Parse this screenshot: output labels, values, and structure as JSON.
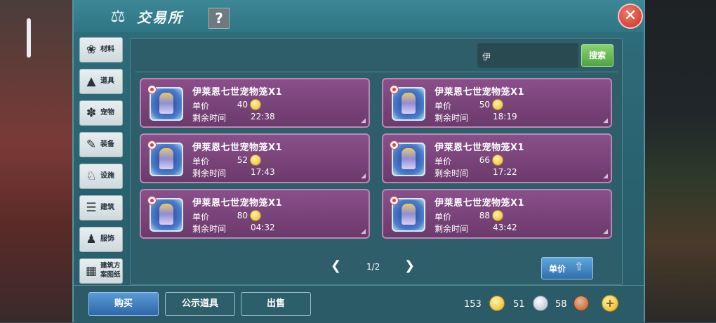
{
  "window": {
    "title": "交易所",
    "help_label": "?",
    "close_label": "✕"
  },
  "sidebar": {
    "items": [
      {
        "label": "材料",
        "icon": "material-icon"
      },
      {
        "label": "道具",
        "icon": "flask-icon"
      },
      {
        "label": "宠物",
        "icon": "paw-icon"
      },
      {
        "label": "装备",
        "icon": "equipment-icon"
      },
      {
        "label": "设施",
        "icon": "facility-icon"
      },
      {
        "label": "建筑",
        "icon": "building-icon"
      },
      {
        "label": "服饰",
        "icon": "clothing-icon"
      },
      {
        "label": "建筑方案图纸",
        "icon": "blueprint-icon"
      }
    ]
  },
  "search": {
    "value": "伊",
    "button_label": "搜索"
  },
  "listings": {
    "price_label": "单价",
    "time_label": "剩余时间",
    "items": [
      {
        "name": "伊莱恩七世宠物笼X1",
        "price": "40",
        "time": "22:38"
      },
      {
        "name": "伊莱恩七世宠物笼X1",
        "price": "50",
        "time": "18:19"
      },
      {
        "name": "伊莱恩七世宠物笼X1",
        "price": "52",
        "time": "17:43"
      },
      {
        "name": "伊莱恩七世宠物笼X1",
        "price": "66",
        "time": "17:22"
      },
      {
        "name": "伊莱恩七世宠物笼X1",
        "price": "80",
        "time": "04:32"
      },
      {
        "name": "伊莱恩七世宠物笼X1",
        "price": "88",
        "time": "43:42"
      }
    ]
  },
  "pagination": {
    "text": "1/2",
    "prev": "❮",
    "next": "❯"
  },
  "sort": {
    "label": "单价"
  },
  "bottom": {
    "buy": "购买",
    "show": "公示道具",
    "sell": "出售"
  },
  "currency": {
    "gold": "153",
    "silver": "51",
    "bronze": "58",
    "add": "+"
  }
}
